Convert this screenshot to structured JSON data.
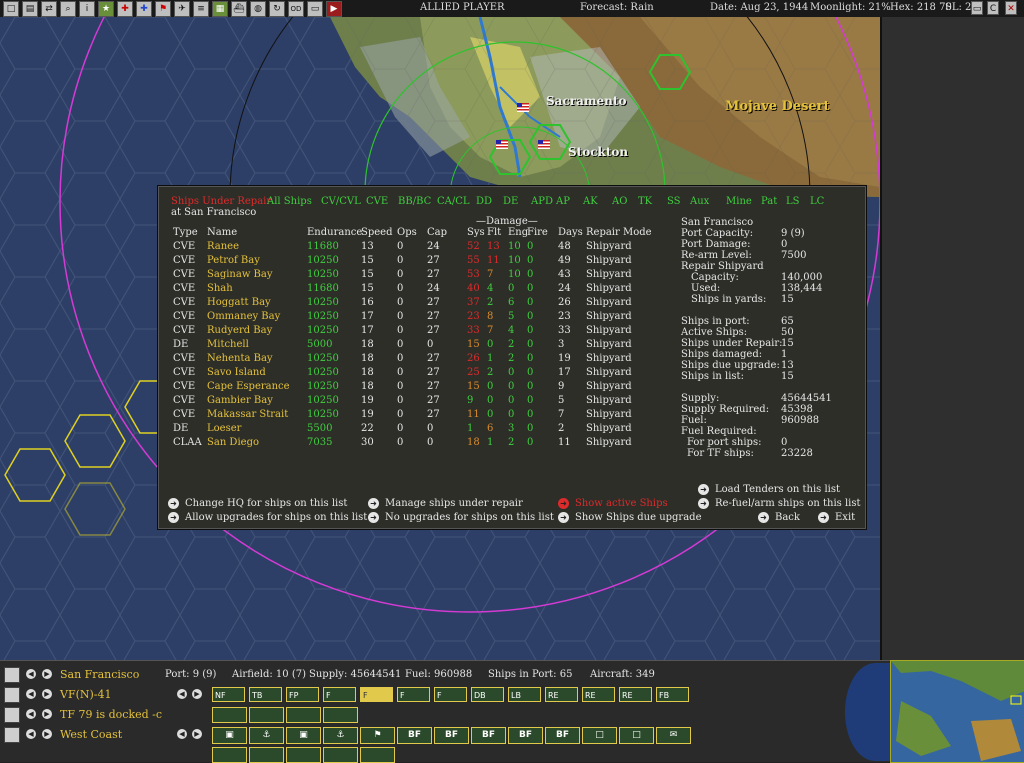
{
  "topbar": {
    "buttons": [
      "box",
      "doc",
      "swap",
      "search",
      "info",
      "star",
      "cross-red",
      "cross-blue",
      "flag",
      "plane",
      "lines",
      "factory",
      "ship",
      "globe",
      "refresh",
      "OD",
      "card",
      "play"
    ],
    "player": "ALLIED PLAYER",
    "forecast": "Forecast: Rain",
    "date": "Date: Aug 23, 1944",
    "moonlight": "Moonlight: 21%",
    "hex": "Hex: 218  70",
    "sl": "SL: 2"
  },
  "map": {
    "labels": {
      "sacramento": "Sacramento",
      "stockton": "Stockton",
      "mojave": "Mojave Desert"
    }
  },
  "panel": {
    "title": "Ships Under Repair",
    "location": "at San Francisco",
    "tabs": [
      "All Ships",
      "CV/CVL",
      "CVE",
      "BB/BC",
      "CA/CL",
      "DD",
      "DE",
      "APD",
      "AP",
      "AK",
      "AO",
      "TK",
      "SS",
      "Aux",
      "Mine",
      "Pat",
      "LS",
      "LC"
    ],
    "damage_header": "—Damage—",
    "columns": [
      "Type",
      "Name",
      "Endurance",
      "Speed",
      "Ops",
      "Cap",
      "Sys",
      "Flt",
      "Eng",
      "Fire",
      "Days",
      "Repair Mode"
    ],
    "rows": [
      {
        "type": "CVE",
        "name": "Ranee",
        "end": "11680",
        "speed": "13",
        "ops": "0",
        "cap": "24",
        "sys": "52",
        "flt": "13",
        "eng": "10",
        "fire": "0",
        "days": "48",
        "mode": "Shipyard"
      },
      {
        "type": "CVE",
        "name": "Petrof Bay",
        "end": "10250",
        "speed": "15",
        "ops": "0",
        "cap": "27",
        "sys": "55",
        "flt": "11",
        "eng": "10",
        "fire": "0",
        "days": "49",
        "mode": "Shipyard"
      },
      {
        "type": "CVE",
        "name": "Saginaw Bay",
        "end": "10250",
        "speed": "15",
        "ops": "0",
        "cap": "27",
        "sys": "53",
        "flt": "7",
        "eng": "10",
        "fire": "0",
        "days": "43",
        "mode": "Shipyard"
      },
      {
        "type": "CVE",
        "name": "Shah",
        "end": "11680",
        "speed": "15",
        "ops": "0",
        "cap": "24",
        "sys": "40",
        "flt": "4",
        "eng": "0",
        "fire": "0",
        "days": "24",
        "mode": "Shipyard"
      },
      {
        "type": "CVE",
        "name": "Hoggatt Bay",
        "end": "10250",
        "speed": "16",
        "ops": "0",
        "cap": "27",
        "sys": "37",
        "flt": "2",
        "eng": "6",
        "fire": "0",
        "days": "26",
        "mode": "Shipyard"
      },
      {
        "type": "CVE",
        "name": "Ommaney Bay",
        "end": "10250",
        "speed": "17",
        "ops": "0",
        "cap": "27",
        "sys": "23",
        "flt": "8",
        "eng": "5",
        "fire": "0",
        "days": "23",
        "mode": "Shipyard"
      },
      {
        "type": "CVE",
        "name": "Rudyerd Bay",
        "end": "10250",
        "speed": "17",
        "ops": "0",
        "cap": "27",
        "sys": "33",
        "flt": "7",
        "eng": "4",
        "fire": "0",
        "days": "33",
        "mode": "Shipyard"
      },
      {
        "type": "DE",
        "name": "Mitchell",
        "end": "5000",
        "speed": "18",
        "ops": "0",
        "cap": "0",
        "sys": "15",
        "flt": "0",
        "eng": "2",
        "fire": "0",
        "days": "3",
        "mode": "Shipyard"
      },
      {
        "type": "CVE",
        "name": "Nehenta Bay",
        "end": "10250",
        "speed": "18",
        "ops": "0",
        "cap": "27",
        "sys": "26",
        "flt": "1",
        "eng": "2",
        "fire": "0",
        "days": "19",
        "mode": "Shipyard"
      },
      {
        "type": "CVE",
        "name": "Savo Island",
        "end": "10250",
        "speed": "18",
        "ops": "0",
        "cap": "27",
        "sys": "25",
        "flt": "2",
        "eng": "0",
        "fire": "0",
        "days": "17",
        "mode": "Shipyard"
      },
      {
        "type": "CVE",
        "name": "Cape Esperance",
        "end": "10250",
        "speed": "18",
        "ops": "0",
        "cap": "27",
        "sys": "15",
        "flt": "0",
        "eng": "0",
        "fire": "0",
        "days": "9",
        "mode": "Shipyard"
      },
      {
        "type": "CVE",
        "name": "Gambier Bay",
        "end": "10250",
        "speed": "19",
        "ops": "0",
        "cap": "27",
        "sys": "9",
        "flt": "0",
        "eng": "0",
        "fire": "0",
        "days": "5",
        "mode": "Shipyard"
      },
      {
        "type": "CVE",
        "name": "Makassar Strait",
        "end": "10250",
        "speed": "19",
        "ops": "0",
        "cap": "27",
        "sys": "11",
        "flt": "0",
        "eng": "0",
        "fire": "0",
        "days": "7",
        "mode": "Shipyard"
      },
      {
        "type": "DE",
        "name": "Loeser",
        "end": "5500",
        "speed": "22",
        "ops": "0",
        "cap": "0",
        "sys": "1",
        "flt": "6",
        "eng": "3",
        "fire": "0",
        "days": "2",
        "mode": "Shipyard"
      },
      {
        "type": "CLAA",
        "name": "San Diego",
        "end": "7035",
        "speed": "30",
        "ops": "0",
        "cap": "0",
        "sys": "18",
        "flt": "1",
        "eng": "2",
        "fire": "0",
        "days": "11",
        "mode": "Shipyard"
      }
    ],
    "info": {
      "base": "San Francisco",
      "port_capacity_label": "Port Capacity:",
      "port_capacity": "9 (9)",
      "port_damage_label": "Port Damage:",
      "port_damage": "0",
      "rearm_label": "Re-arm Level:",
      "rearm": "7500",
      "repair_label": "Repair Shipyard",
      "capacity_label": "Capacity:",
      "capacity": "140,000",
      "used_label": "Used:",
      "used": "138,444",
      "in_yards_label": "Ships in yards:",
      "in_yards": "15",
      "in_port_label": "Ships in port:",
      "in_port": "65",
      "active_label": "Active Ships:",
      "active": "50",
      "under_repair_label": "Ships under Repair:",
      "under_repair": "15",
      "damaged_label": "Ships damaged:",
      "damaged": "1",
      "due_upgrade_label": "Ships due upgrade:",
      "due_upgrade": "13",
      "in_list_label": "Ships in list:",
      "in_list": "15",
      "supply_label": "Supply:",
      "supply": "45644541",
      "supply_req_label": "Supply Required:",
      "supply_req": "45398",
      "fuel_label": "Fuel:",
      "fuel": "960988",
      "fuel_req_label": "Fuel Required:",
      "port_ships_label": "For port ships:",
      "port_ships": "0",
      "tf_ships_label": "For TF ships:",
      "tf_ships": "23228"
    },
    "actions": {
      "change_hq": "Change HQ for ships on this list",
      "allow_upgrades": "Allow upgrades for ships on this list",
      "manage_repair": "Manage ships under repair",
      "no_upgrades": "No upgrades for ships on this list",
      "show_active": "Show active Ships",
      "show_due": "Show Ships due upgrade",
      "load_tenders": "Load Tenders on this list",
      "refuel": "Re-fuel/arm ships on this list",
      "back": "Back",
      "exit": "Exit"
    }
  },
  "bottom": {
    "base": "San Francisco",
    "port": "Port: 9 (9)",
    "airfield": "Airfield: 10 (7)",
    "supply": "Supply: 45644541",
    "fuel": "Fuel: 960988",
    "ships_in_port": "Ships in Port: 65",
    "aircraft": "Aircraft: 349",
    "air_unit": "VF(N)-41",
    "tf": "TF 79 is docked -c",
    "command": "West Coast",
    "air_slots": [
      "NF",
      "TB",
      "FP",
      "F",
      "F",
      "F",
      "F",
      "DB",
      "LB",
      "RE",
      "RE",
      "RE",
      "FB"
    ],
    "ground_slots": [
      "BF",
      "BF",
      "BF",
      "BF",
      "BF"
    ]
  }
}
